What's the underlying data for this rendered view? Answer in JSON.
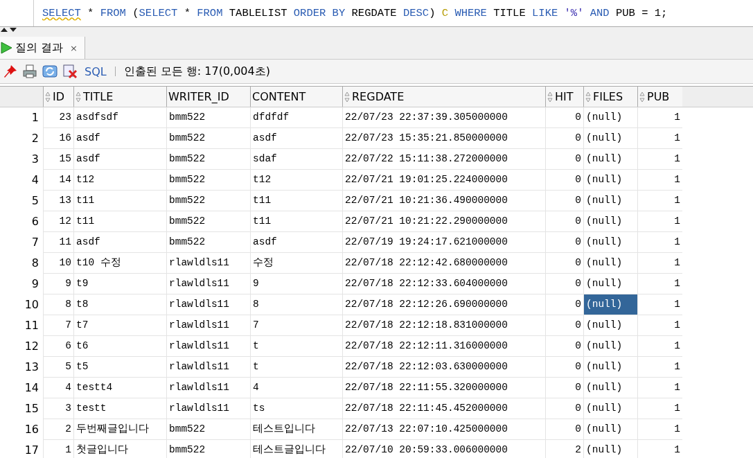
{
  "editor": {
    "sql": [
      {
        "text": "SELECT",
        "kind": "keyword"
      },
      {
        "text": " * ",
        "kind": "plain"
      },
      {
        "text": "FROM",
        "kind": "keyword"
      },
      {
        "text": " (",
        "kind": "plain"
      },
      {
        "text": "SELECT",
        "kind": "keyword"
      },
      {
        "text": " * ",
        "kind": "plain"
      },
      {
        "text": "FROM",
        "kind": "keyword"
      },
      {
        "text": " TABLELIST ",
        "kind": "plain"
      },
      {
        "text": "ORDER BY",
        "kind": "keyword"
      },
      {
        "text": " REGDATE ",
        "kind": "plain"
      },
      {
        "text": "DESC",
        "kind": "keyword"
      },
      {
        "text": ") ",
        "kind": "plain"
      },
      {
        "text": "C ",
        "kind": "alias"
      },
      {
        "text": "WHERE",
        "kind": "keyword"
      },
      {
        "text": " TITLE ",
        "kind": "plain"
      },
      {
        "text": "LIKE",
        "kind": "keyword"
      },
      {
        "text": " '%' ",
        "kind": "string"
      },
      {
        "text": "AND",
        "kind": "keyword"
      },
      {
        "text": " PUB = 1;",
        "kind": "plain"
      }
    ]
  },
  "tabs": [
    {
      "label": "질의 결과",
      "close": "×",
      "selected": true
    }
  ],
  "toolbar": {
    "sql_label": "SQL",
    "status": "인출된 모든 행: 17(0,004초)"
  },
  "table": {
    "columns": [
      {
        "name": "ID",
        "kind": "number",
        "sortable": true
      },
      {
        "name": "TITLE",
        "kind": "text",
        "sortable": true
      },
      {
        "name": "WRITER_ID",
        "kind": "text",
        "sortable": false
      },
      {
        "name": "CONTENT",
        "kind": "text",
        "sortable": false
      },
      {
        "name": "REGDATE",
        "kind": "text",
        "sortable": true
      },
      {
        "name": "HIT",
        "kind": "number",
        "sortable": true
      },
      {
        "name": "FILES",
        "kind": "text",
        "sortable": true
      },
      {
        "name": "PUB",
        "kind": "number",
        "sortable": true
      }
    ],
    "rows": [
      {
        "num": "1",
        "cells": [
          "23",
          "asdfsdf",
          "bmm522",
          "dfdfdf",
          "22/07/23 22:37:39.305000000",
          "0",
          "(null)",
          "1"
        ],
        "files_selected": false
      },
      {
        "num": "2",
        "cells": [
          "16",
          "asdf",
          "bmm522",
          "asdf",
          "22/07/23 15:35:21.850000000",
          "0",
          "(null)",
          "1"
        ],
        "files_selected": false
      },
      {
        "num": "3",
        "cells": [
          "15",
          "asdf",
          "bmm522",
          "sdaf",
          "22/07/22 15:11:38.272000000",
          "0",
          "(null)",
          "1"
        ],
        "files_selected": false
      },
      {
        "num": "4",
        "cells": [
          "14",
          "t12",
          "bmm522",
          "t12",
          "22/07/21 19:01:25.224000000",
          "0",
          "(null)",
          "1"
        ],
        "files_selected": false
      },
      {
        "num": "5",
        "cells": [
          "13",
          "t11",
          "bmm522",
          "t11",
          "22/07/21 10:21:36.490000000",
          "0",
          "(null)",
          "1"
        ],
        "files_selected": false
      },
      {
        "num": "6",
        "cells": [
          "12",
          "t11",
          "bmm522",
          "t11",
          "22/07/21 10:21:22.290000000",
          "0",
          "(null)",
          "1"
        ],
        "files_selected": false
      },
      {
        "num": "7",
        "cells": [
          "11",
          "asdf",
          "bmm522",
          "asdf",
          "22/07/19 19:24:17.621000000",
          "0",
          "(null)",
          "1"
        ],
        "files_selected": false
      },
      {
        "num": "8",
        "cells": [
          "10",
          "t10 수정",
          "rlawldls11",
          "수정",
          "22/07/18 22:12:42.680000000",
          "0",
          "(null)",
          "1"
        ],
        "files_selected": false
      },
      {
        "num": "9",
        "cells": [
          "9",
          "t9",
          "rlawldls11",
          "9",
          "22/07/18 22:12:33.604000000",
          "0",
          "(null)",
          "1"
        ],
        "files_selected": false
      },
      {
        "num": "10",
        "cells": [
          "8",
          "t8",
          "rlawldls11",
          "8",
          "22/07/18 22:12:26.690000000",
          "0",
          "(null)",
          "1"
        ],
        "files_selected": true
      },
      {
        "num": "11",
        "cells": [
          "7",
          "t7",
          "rlawldls11",
          "7",
          "22/07/18 22:12:18.831000000",
          "0",
          "(null)",
          "1"
        ],
        "files_selected": false
      },
      {
        "num": "12",
        "cells": [
          "6",
          "t6",
          "rlawldls11",
          "t",
          "22/07/18 22:12:11.316000000",
          "0",
          "(null)",
          "1"
        ],
        "files_selected": false
      },
      {
        "num": "13",
        "cells": [
          "5",
          "t5",
          "rlawldls11",
          "t",
          "22/07/18 22:12:03.630000000",
          "0",
          "(null)",
          "1"
        ],
        "files_selected": false
      },
      {
        "num": "14",
        "cells": [
          "4",
          "testt4",
          "rlawldls11",
          "4",
          "22/07/18 22:11:55.320000000",
          "0",
          "(null)",
          "1"
        ],
        "files_selected": false
      },
      {
        "num": "15",
        "cells": [
          "3",
          "testt",
          "rlawldls11",
          "ts",
          "22/07/18 22:11:45.452000000",
          "0",
          "(null)",
          "1"
        ],
        "files_selected": false
      },
      {
        "num": "16",
        "cells": [
          "2",
          "두번째글입니다",
          "bmm522",
          "테스트입니다",
          "22/07/13 22:07:10.425000000",
          "0",
          "(null)",
          "1"
        ],
        "files_selected": false
      },
      {
        "num": "17",
        "cells": [
          "1",
          "첫글입니다",
          "bmm522",
          "테스트글입니다",
          "22/07/10 20:59:33.006000000",
          "2",
          "(null)",
          "1"
        ],
        "files_selected": false
      }
    ]
  }
}
